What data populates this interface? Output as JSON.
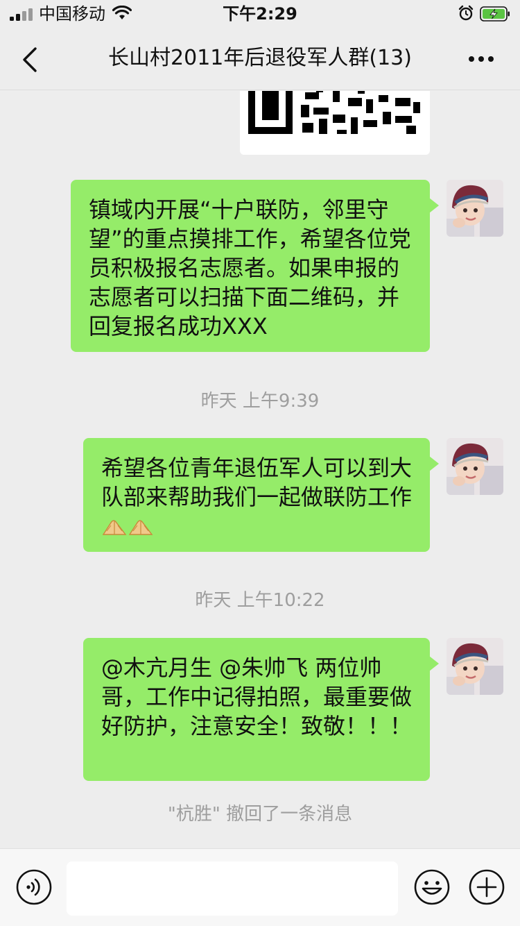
{
  "status_bar": {
    "carrier": "中国移动",
    "time": "下午2:29"
  },
  "header": {
    "title": "长山村2011年后退役军人群(13)"
  },
  "messages": [
    {
      "type": "text",
      "text": "镇域内开展“十户联防，邻里守望”的重点摸排工作，希望各位党员积极报名志愿者。如果申报的志愿者可以扫描下面二维码，并回复报名成功XXX"
    },
    {
      "type": "timestamp",
      "text": "昨天 上午9:39"
    },
    {
      "type": "text",
      "text": "希望各位青年退伍军人可以到大队部来帮助我们一起做联防工作",
      "emoji_icons": [
        "folded-hands-icon",
        "folded-hands-icon"
      ]
    },
    {
      "type": "timestamp",
      "text": "昨天 上午10:22"
    },
    {
      "type": "text",
      "text": "@木亢月生 @朱帅飞 两位帅哥，工作中记得拍照，最重要做好防护，注意安全！致敬！！！"
    },
    {
      "type": "system",
      "text": "\"杭胜\" 撤回了一条消息"
    }
  ],
  "input_bar": {
    "placeholder": "",
    "left_icon": "voice-icon",
    "right_icons": [
      "emoji-icon",
      "plus-icon"
    ]
  },
  "colors": {
    "background": "#ededed",
    "bubble": "#95ec69",
    "timestamp_text": "#9e9e9e",
    "battery": "#5ac443"
  }
}
